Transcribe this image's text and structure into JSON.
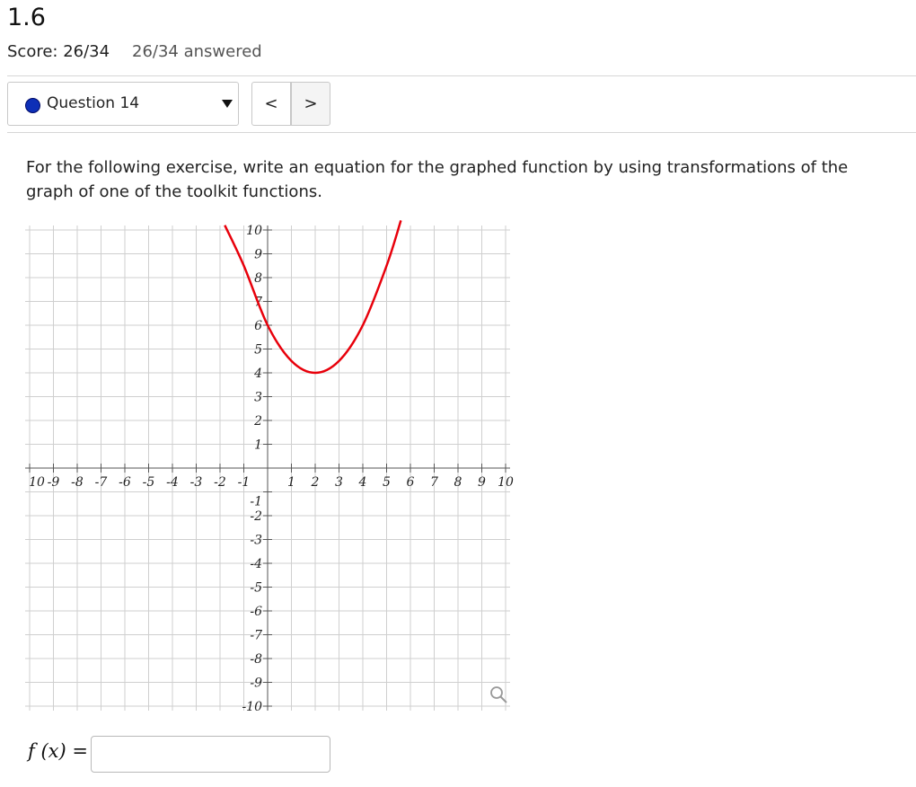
{
  "header": {
    "title": "1.6",
    "score": "Score: 26/34",
    "answered": "26/34 answered"
  },
  "question_nav": {
    "selected": "Question 14",
    "prev_label": "<",
    "next_label": ">"
  },
  "prompt": "For the following exercise, write an equation for the graphed function by using transformations of the graph of one of the toolkit functions.",
  "chart_data": {
    "type": "line",
    "xlim": [
      -10,
      10
    ],
    "ylim": [
      -10,
      10
    ],
    "grid": true,
    "x_tick_labels": [
      "10",
      "-9",
      "-8",
      "-7",
      "-6",
      "-5",
      "-4",
      "-3",
      "-2",
      "-1",
      "1",
      "2",
      "3",
      "4",
      "5",
      "6",
      "7",
      "8",
      "9",
      "10"
    ],
    "y_tick_labels": [
      "10",
      "9",
      "8",
      "7",
      "6",
      "5",
      "4",
      "3",
      "2",
      "1",
      "-1",
      "-2",
      "-3",
      "-4",
      "-5",
      "-6",
      "-7",
      "-8",
      "-9",
      "-10"
    ],
    "series": [
      {
        "color": "#e8000b",
        "points": [
          [
            -1.8,
            10.2
          ],
          [
            -1,
            8.5
          ],
          [
            0,
            6
          ],
          [
            1,
            4.5
          ],
          [
            2,
            4
          ],
          [
            3,
            4.5
          ],
          [
            4,
            6
          ],
          [
            5,
            8.5
          ],
          [
            5.6,
            10.4
          ]
        ]
      }
    ]
  },
  "answer": {
    "label": "f (x) =",
    "value": ""
  },
  "icons": {
    "zoom": "magnifier-icon"
  }
}
